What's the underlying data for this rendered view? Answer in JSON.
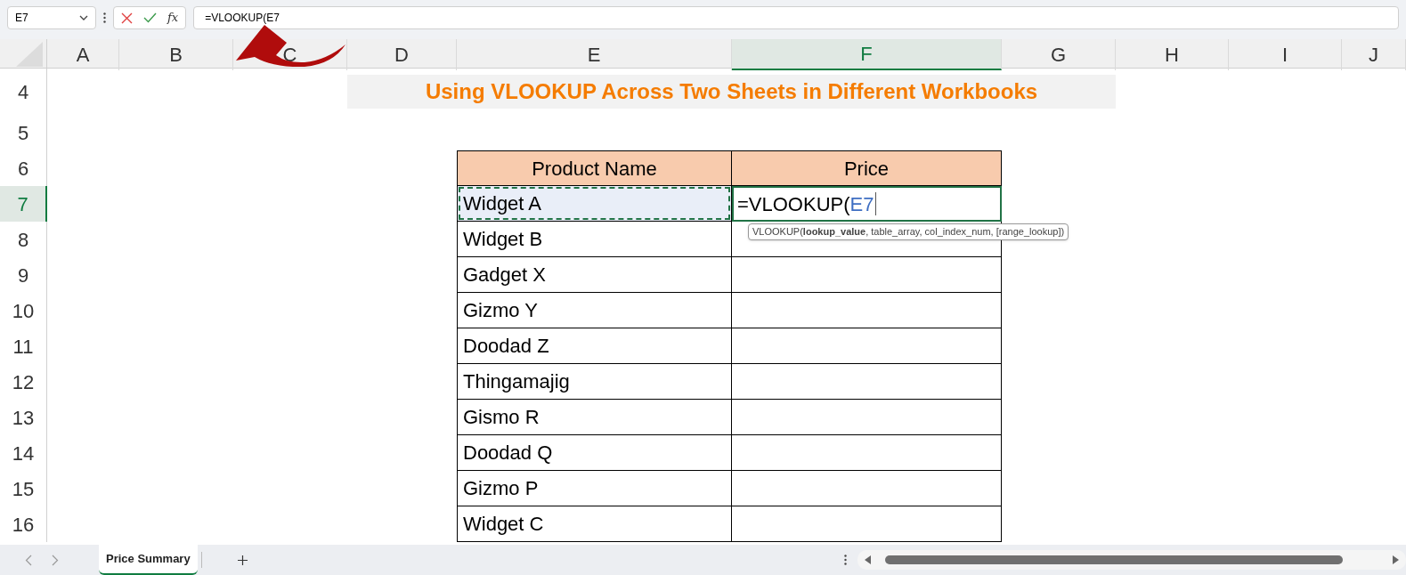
{
  "formula_bar": {
    "name_box": "E7",
    "function_label": "fx",
    "formula": "=VLOOKUP(E7"
  },
  "columns": [
    {
      "label": "A",
      "selected": false
    },
    {
      "label": "B",
      "selected": false
    },
    {
      "label": "C",
      "selected": false
    },
    {
      "label": "D",
      "selected": false
    },
    {
      "label": "E",
      "selected": false
    },
    {
      "label": "F",
      "selected": true
    },
    {
      "label": "G",
      "selected": false
    },
    {
      "label": "H",
      "selected": false
    },
    {
      "label": "I",
      "selected": false
    },
    {
      "label": "J",
      "selected": false
    }
  ],
  "row_numbers": [
    {
      "label": "4",
      "selected": false
    },
    {
      "label": "5",
      "selected": false
    },
    {
      "label": "6",
      "selected": false
    },
    {
      "label": "7",
      "selected": true
    },
    {
      "label": "8",
      "selected": false
    },
    {
      "label": "9",
      "selected": false
    },
    {
      "label": "10",
      "selected": false
    },
    {
      "label": "11",
      "selected": false
    },
    {
      "label": "12",
      "selected": false
    },
    {
      "label": "13",
      "selected": false
    },
    {
      "label": "14",
      "selected": false
    },
    {
      "label": "15",
      "selected": false
    },
    {
      "label": "16",
      "selected": false
    }
  ],
  "title": "Using VLOOKUP Across Two Sheets in Different Workbooks",
  "table": {
    "columns": [
      "Product Name",
      "Price"
    ],
    "rows": [
      {
        "product": "Widget A",
        "copied": true,
        "editing": {
          "text": "=VLOOKUP(",
          "reference": "E7"
        }
      },
      {
        "product": "Widget B",
        "copied": false
      },
      {
        "product": "Gadget X",
        "copied": false
      },
      {
        "product": "Gizmo Y",
        "copied": false
      },
      {
        "product": "Doodad Z",
        "copied": false
      },
      {
        "product": "Thingamajig",
        "copied": false
      },
      {
        "product": "Gismo R",
        "copied": false
      },
      {
        "product": "Doodad Q",
        "copied": false
      },
      {
        "product": "Gizmo P",
        "copied": false
      },
      {
        "product": "Widget C",
        "copied": false
      }
    ]
  },
  "tooltip": "VLOOKUP(**lookup_value**, table_array, col_index_num, [range_lookup])",
  "sheet_tabs": [
    {
      "label": "Price Summary",
      "selected": true
    }
  ]
}
